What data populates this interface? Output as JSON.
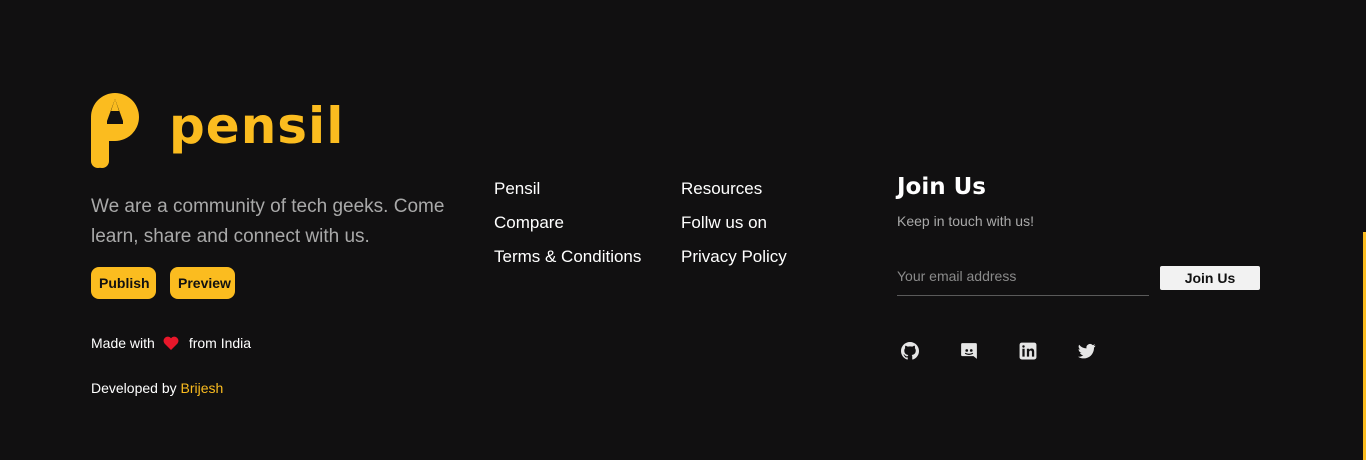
{
  "brand": {
    "name": "pensil",
    "color": "#fbbc1f"
  },
  "tagline": "We are a community of tech geeks. Come learn, share and connect with us.",
  "buttons": {
    "publish": "Publish",
    "preview": "Preview"
  },
  "made_with": {
    "prefix": "Made with",
    "suffix": "from India",
    "icon": "heart-icon"
  },
  "developed": {
    "prefix": "Developed by",
    "author": "Brijesh"
  },
  "links": {
    "col1": [
      "Pensil",
      "Compare",
      "Terms & Conditions"
    ],
    "col2": [
      "Resources",
      "Follw us on",
      "Privacy Policy"
    ]
  },
  "join": {
    "title": "Join Us",
    "subtitle": "Keep in touch with us!",
    "email_placeholder": "Your email address",
    "button": "Join Us"
  },
  "socials": [
    "github-icon",
    "discord-icon",
    "linkedin-icon",
    "twitter-icon"
  ],
  "colors": {
    "background": "#111011",
    "accent": "#fbbc1f",
    "muted_text": "#a9a9a9"
  }
}
